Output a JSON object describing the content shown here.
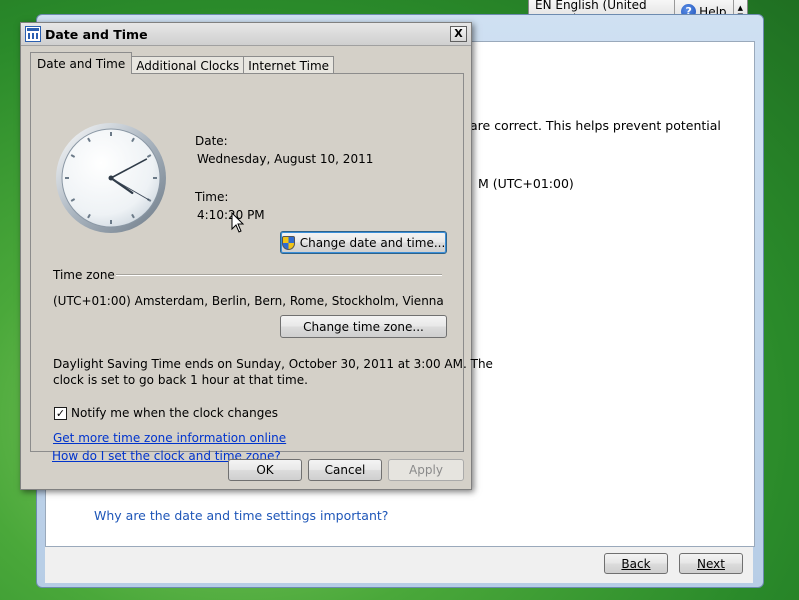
{
  "language_bar": {
    "language": "EN English (United States)",
    "help": "Help"
  },
  "setup": {
    "partial_text_1": "are correct. This helps prevent potential",
    "partial_text_2": "M (UTC+01:00)",
    "link_important": "Why are the date and time settings important?",
    "back_label": "Back",
    "next_label": "Next"
  },
  "dialog": {
    "title": "Date and Time",
    "close_glyph": "X",
    "tabs": [
      {
        "label": "Date and Time",
        "active": true
      },
      {
        "label": "Additional Clocks",
        "active": false
      },
      {
        "label": "Internet Time",
        "active": false
      }
    ],
    "date_label": "Date:",
    "date_value": "Wednesday, August 10, 2011",
    "time_label": "Time:",
    "time_value": "4:10:20 PM",
    "change_datetime_label": "Change date and time...",
    "timezone_group_label": "Time zone",
    "timezone_value": "(UTC+01:00) Amsterdam, Berlin, Bern, Rome, Stockholm, Vienna",
    "change_timezone_label": "Change time zone...",
    "dst_line1": "Daylight Saving Time ends on Sunday, October 30, 2011 at 3:00 AM. The",
    "dst_line2": "clock is set to go back 1 hour at that time.",
    "notify_label": "Notify me when the clock changes",
    "notify_checked": true,
    "link_more_info": "Get more time zone information online",
    "link_how_set": "How do I set the clock and time zone?",
    "ok_label": "OK",
    "cancel_label": "Cancel",
    "apply_label": "Apply"
  },
  "colors": {
    "link": "#0033cc",
    "dialog_face": "#d4d0c8",
    "desktop": "#4aa83a"
  }
}
